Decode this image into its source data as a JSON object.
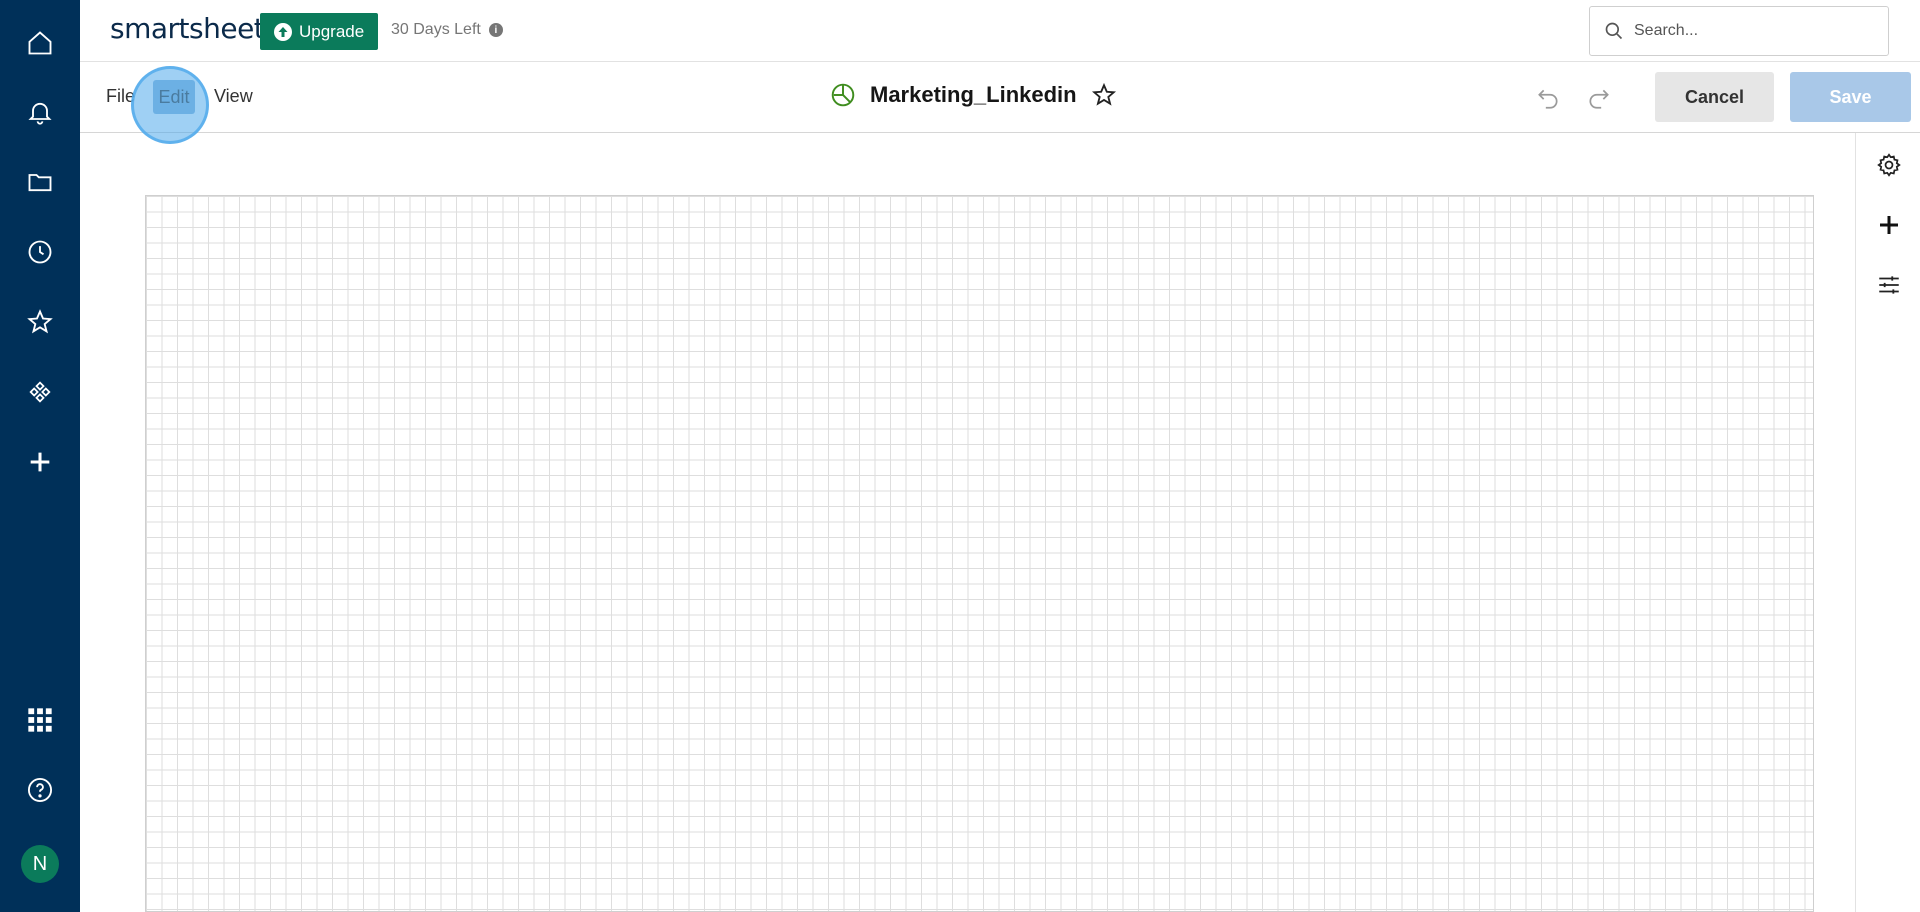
{
  "rail": {
    "items": [
      {
        "name": "home-icon"
      },
      {
        "name": "bell-icon"
      },
      {
        "name": "folder-icon"
      },
      {
        "name": "clock-icon"
      },
      {
        "name": "star-icon"
      },
      {
        "name": "solutions-icon"
      },
      {
        "name": "plus-icon"
      }
    ],
    "bottom": [
      {
        "name": "apps-grid-icon"
      },
      {
        "name": "help-icon"
      }
    ],
    "avatar_initial": "N",
    "background": "#003059"
  },
  "header": {
    "logo": "smartsheet",
    "upgrade_label": "Upgrade",
    "days_left": "30 Days Left",
    "search_placeholder": "Search...",
    "brand_green": "#0b7b5b"
  },
  "toolbar": {
    "menu": {
      "file": "File",
      "edit": "Edit",
      "view": "View"
    },
    "title": "Marketing_Linkedin",
    "cancel_label": "Cancel",
    "save_label": "Save"
  },
  "right_panel": {
    "items": [
      {
        "name": "gear-icon"
      },
      {
        "name": "add-widget-icon"
      },
      {
        "name": "sliders-icon"
      }
    ]
  }
}
